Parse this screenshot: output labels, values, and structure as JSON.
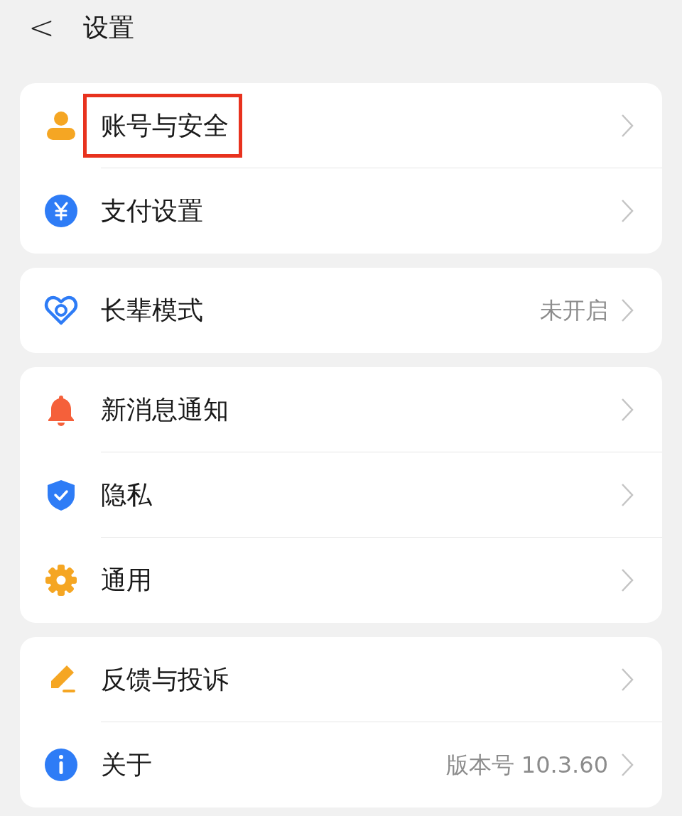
{
  "header": {
    "back": "<",
    "title": "设置"
  },
  "groups": [
    {
      "items": [
        {
          "kind": "person",
          "label": "账号与安全",
          "highlighted": true
        },
        {
          "kind": "yen",
          "label": "支付设置",
          "highlighted": false
        }
      ]
    },
    {
      "items": [
        {
          "kind": "heart",
          "label": "长辈模式",
          "value": "未开启",
          "highlighted": false
        }
      ]
    },
    {
      "items": [
        {
          "kind": "bell",
          "label": "新消息通知",
          "highlighted": false
        },
        {
          "kind": "shield",
          "label": "隐私",
          "highlighted": false
        },
        {
          "kind": "gear",
          "label": "通用",
          "highlighted": false
        }
      ]
    },
    {
      "items": [
        {
          "kind": "pencil",
          "label": "反馈与投诉",
          "highlighted": false
        },
        {
          "kind": "info",
          "label": "关于",
          "value": "版本号 10.3.60",
          "highlighted": false
        }
      ]
    }
  ]
}
